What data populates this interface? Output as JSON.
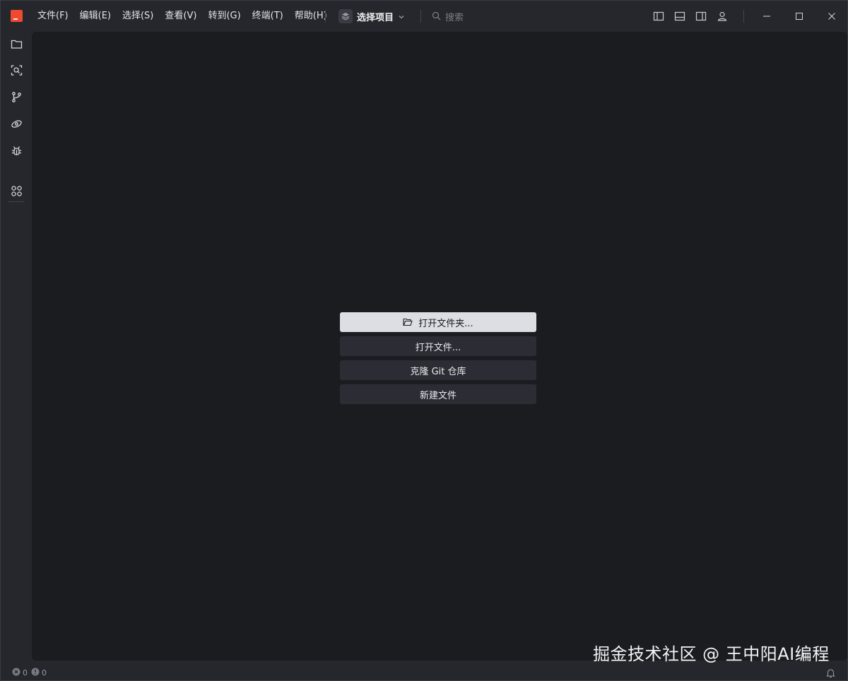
{
  "menu": [
    {
      "label": "文件(F)"
    },
    {
      "label": "编辑(E)"
    },
    {
      "label": "选择(S)"
    },
    {
      "label": "查看(V)"
    },
    {
      "label": "转到(G)"
    },
    {
      "label": "终端(T)"
    },
    {
      "label": "帮助(H)"
    }
  ],
  "project": {
    "label": "选择项目"
  },
  "search": {
    "placeholder": "搜索"
  },
  "actions": {
    "open_folder": "打开文件夹...",
    "open_file": "打开文件...",
    "clone_git": "克隆 Git 仓库",
    "new_file": "新建文件"
  },
  "status": {
    "errors": "0",
    "warnings": "0"
  },
  "watermark": "掘金技术社区 @ 王中阳AI编程",
  "colors": {
    "accent": "#ef4a2f",
    "editor_bg": "#1b1c20",
    "chrome_bg": "#26272d",
    "primary_button": "#dcdee4"
  }
}
